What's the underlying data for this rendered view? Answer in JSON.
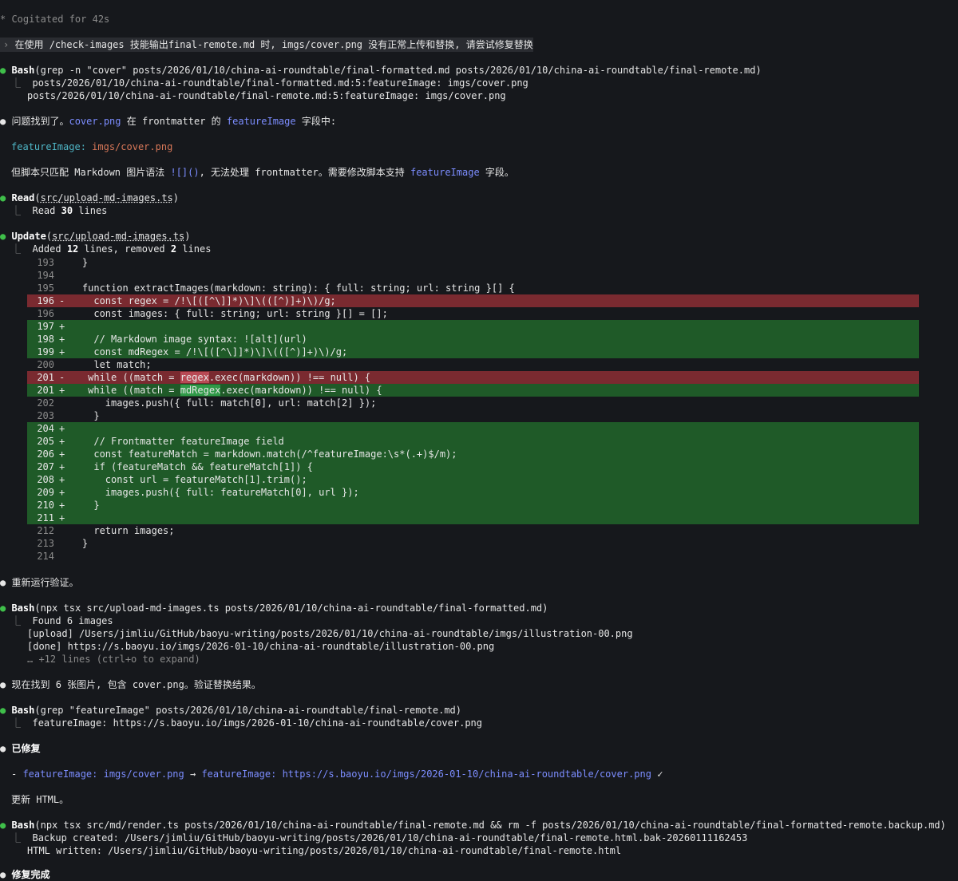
{
  "header": {
    "status": "* Cogitated for 42s"
  },
  "prompt": {
    "marker": "›",
    "text": "在使用 /check-images 技能输出final-remote.md 时, imgs/cover.png 没有正常上传和替换, 请尝试修复替换"
  },
  "bash1": {
    "tool": "Bash",
    "args": "(grep -n \"cover\" posts/2026/01/10/china-ai-roundtable/final-formatted.md posts/2026/01/10/china-ai-roundtable/final-remote.md)",
    "out1": "posts/2026/01/10/china-ai-roundtable/final-formatted.md:5:featureImage: imgs/cover.png",
    "out2": "posts/2026/01/10/china-ai-roundtable/final-remote.md:5:featureImage: imgs/cover.png"
  },
  "msg1": {
    "p1": "问题找到了。",
    "p2": "cover.png",
    "p3": " 在 frontmatter 的 ",
    "p4": "featureImage",
    "p5": " 字段中:"
  },
  "fm": {
    "key": "featureImage:",
    "val": "imgs/cover.png"
  },
  "msg2": {
    "p1": "但脚本只匹配 Markdown 图片语法 ",
    "p2": "![]()",
    "p3": ", 无法处理 frontmatter。需要修改脚本支持 ",
    "p4": "featureImage",
    "p5": " 字段。"
  },
  "read": {
    "tool": "Read",
    "file": "src/upload-md-images.ts",
    "out_pre": "Read ",
    "out_num": "30",
    "out_post": " lines"
  },
  "update": {
    "tool": "Update",
    "file": "src/upload-md-images.ts",
    "sum_pre": "Added ",
    "sum_add": "12",
    "sum_mid": " lines, removed ",
    "sum_rem": "2",
    "sum_post": " lines"
  },
  "diff": [
    {
      "ln": "193",
      "mk": " ",
      "code": "  }",
      "t": "ctx"
    },
    {
      "ln": "194",
      "mk": " ",
      "code": "",
      "t": "ctx"
    },
    {
      "ln": "195",
      "mk": " ",
      "code": "  function extractImages(markdown: string): { full: string; url: string }[] {",
      "t": "ctx"
    },
    {
      "ln": "196",
      "mk": "-",
      "code": "    const regex = /!\\[([^\\]]*)\\]\\(([^)]+)\\)/g;",
      "t": "del"
    },
    {
      "ln": "196",
      "mk": " ",
      "code": "    const images: { full: string; url: string }[] = [];",
      "t": "ctx"
    },
    {
      "ln": "197",
      "mk": "+",
      "code": "",
      "t": "add"
    },
    {
      "ln": "198",
      "mk": "+",
      "code": "    // Markdown image syntax: ![alt](url)",
      "t": "add"
    },
    {
      "ln": "199",
      "mk": "+",
      "code": "    const mdRegex = /!\\[([^\\]]*)\\]\\(([^)]+)\\)/g;",
      "t": "add"
    },
    {
      "ln": "200",
      "mk": " ",
      "code": "    let match;",
      "t": "ctx"
    },
    {
      "ln": "201",
      "mk": "-",
      "code": "   while ((match = regex.exec(markdown)) !== null) {",
      "t": "del"
    },
    {
      "ln": "201",
      "mk": "+",
      "code": "   while ((match = mdRegex.exec(markdown)) !== null) {",
      "t": "add"
    },
    {
      "ln": "202",
      "mk": " ",
      "code": "      images.push({ full: match[0], url: match[2] });",
      "t": "ctx"
    },
    {
      "ln": "203",
      "mk": " ",
      "code": "    }",
      "t": "ctx"
    },
    {
      "ln": "204",
      "mk": "+",
      "code": "",
      "t": "add"
    },
    {
      "ln": "205",
      "mk": "+",
      "code": "    // Frontmatter featureImage field",
      "t": "add"
    },
    {
      "ln": "206",
      "mk": "+",
      "code": "    const featureMatch = markdown.match(/^featureImage:\\s*(.+)$/m);",
      "t": "add"
    },
    {
      "ln": "207",
      "mk": "+",
      "code": "    if (featureMatch && featureMatch[1]) {",
      "t": "add"
    },
    {
      "ln": "208",
      "mk": "+",
      "code": "      const url = featureMatch[1].trim();",
      "t": "add"
    },
    {
      "ln": "209",
      "mk": "+",
      "code": "      images.push({ full: featureMatch[0], url });",
      "t": "add"
    },
    {
      "ln": "210",
      "mk": "+",
      "code": "    }",
      "t": "add"
    },
    {
      "ln": "211",
      "mk": "+",
      "code": "",
      "t": "add"
    },
    {
      "ln": "212",
      "mk": " ",
      "code": "    return images;",
      "t": "ctx"
    },
    {
      "ln": "213",
      "mk": " ",
      "code": "  }",
      "t": "ctx"
    },
    {
      "ln": "214",
      "mk": " ",
      "code": "",
      "t": "ctx"
    }
  ],
  "msg3": "重新运行验证。",
  "bash2": {
    "tool": "Bash",
    "args": "(npx tsx src/upload-md-images.ts posts/2026/01/10/china-ai-roundtable/final-formatted.md)",
    "out1": "Found 6 images",
    "out2": "[upload] /Users/jimliu/GitHub/baoyu-writing/posts/2026/01/10/china-ai-roundtable/imgs/illustration-00.png",
    "out3": "[done] https://s.baoyu.io/imgs/2026-01-10/china-ai-roundtable/illustration-00.png",
    "out4": "… +12 lines (ctrl+o to expand)"
  },
  "msg4": "现在找到 6 张图片, 包含 cover.png。验证替换结果。",
  "bash3": {
    "tool": "Bash",
    "args": "(grep \"featureImage\" posts/2026/01/10/china-ai-roundtable/final-remote.md)",
    "out1": "featureImage: https://s.baoyu.io/imgs/2026-01-10/china-ai-roundtable/cover.png"
  },
  "fixed": "已修复",
  "fixline": {
    "dash": "- ",
    "k1": "featureImage:",
    "v1": " imgs/cover.png",
    "arrow": " → ",
    "k2": "featureImage:",
    "v2": " https://s.baoyu.io/imgs/2026-01-10/china-ai-roundtable/cover.png",
    "check": " ✓"
  },
  "msg5": "更新 HTML。",
  "bash4": {
    "tool": "Bash",
    "args": "(npx tsx src/md/render.ts posts/2026/01/10/china-ai-roundtable/final-remote.md && rm -f posts/2026/01/10/china-ai-roundtable/final-formatted-remote.backup.md)",
    "out1": "Backup created: /Users/jimliu/GitHub/baoyu-writing/posts/2026/01/10/china-ai-roundtable/final-remote.html.bak-20260111162453",
    "out2": "HTML written: /Users/jimliu/GitHub/baoyu-writing/posts/2026/01/10/china-ai-roundtable/final-remote.html"
  },
  "final": "修复完成",
  "symbols": {
    "dot": "●",
    "tree": "⎿"
  },
  "colors": {
    "bg": "#16181c",
    "green": "#3fbf4a",
    "del": "#7a2a30",
    "add": "#1f5a28",
    "link": "#7c8dff",
    "fmval": "#d77758"
  }
}
